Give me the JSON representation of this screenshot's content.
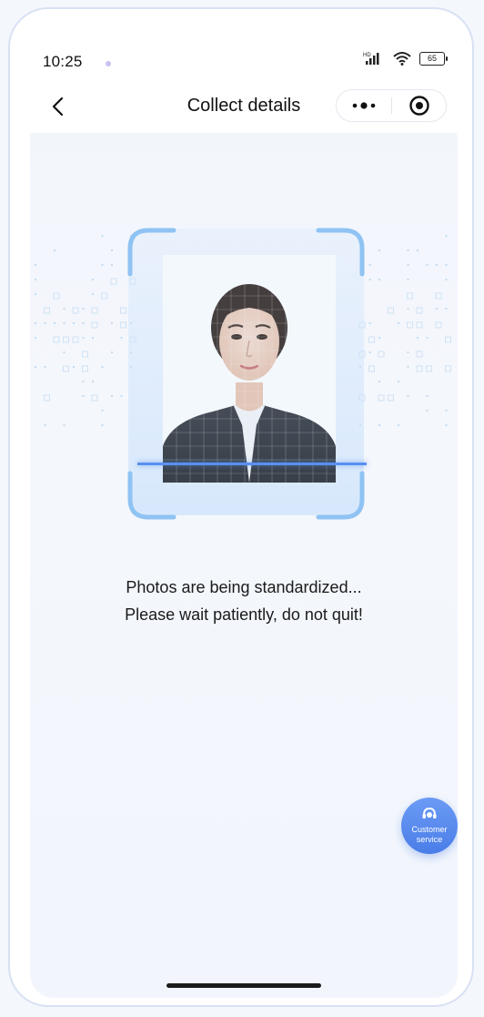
{
  "status_bar": {
    "time": "10:25",
    "network_label": "HD",
    "battery_level": "65"
  },
  "nav": {
    "title": "Collect details",
    "more_icon": "more-dots-icon",
    "close_icon": "target-close-icon",
    "back_icon": "chevron-left-icon"
  },
  "main": {
    "status_line_1": "Photos are being standardized...",
    "status_line_2": "Please wait patiently, do not quit!"
  },
  "customer_service": {
    "label_line_1": "Customer",
    "label_line_2": "service",
    "icon": "headset-icon"
  },
  "colors": {
    "accent": "#4a7de8",
    "scan_line": "#5a8ff0",
    "background": "#f2f5fb"
  }
}
